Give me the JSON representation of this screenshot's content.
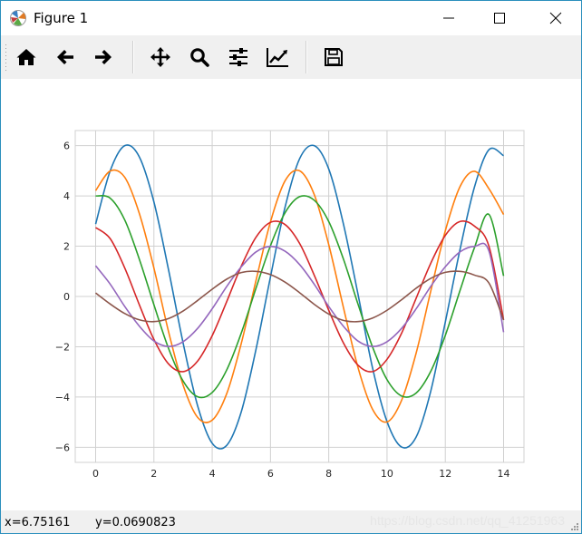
{
  "window": {
    "title": "Figure 1"
  },
  "toolbar": {
    "buttons": [
      {
        "name": "home-button",
        "icon": "home-icon"
      },
      {
        "name": "back-button",
        "icon": "arrow-left-icon"
      },
      {
        "name": "forward-button",
        "icon": "arrow-right-icon"
      },
      {
        "name": "pan-button",
        "icon": "move-arrows-icon"
      },
      {
        "name": "zoom-button",
        "icon": "magnifier-icon"
      },
      {
        "name": "subplots-button",
        "icon": "sliders-icon"
      },
      {
        "name": "edit-axes-button",
        "icon": "line-chart-icon"
      },
      {
        "name": "save-button",
        "icon": "floppy-disk-icon"
      }
    ]
  },
  "status": {
    "x_readout": "x=6.75161",
    "y_readout": "y=0.0690823",
    "watermark": "https://blog.csdn.net/qq_41251963"
  },
  "colors": {
    "window_border": "#2b8fbd",
    "toolbar_bg": "#f0f0f0",
    "grid": "#d0d0d0"
  },
  "chart_data": {
    "type": "line",
    "title": "",
    "xlabel": "",
    "ylabel": "",
    "xlim": [
      -0.7,
      14.7
    ],
    "ylim": [
      -6.6,
      6.6
    ],
    "grid": true,
    "x_ticks": [
      0,
      2,
      4,
      6,
      8,
      10,
      12,
      14
    ],
    "y_ticks": [
      -6,
      -4,
      -2,
      0,
      2,
      4,
      6
    ],
    "x_tick_labels": [
      "0",
      "2",
      "4",
      "6",
      "8",
      "10",
      "12",
      "14"
    ],
    "y_tick_labels": [
      "−6",
      "−4",
      "−2",
      "0",
      "2",
      "4",
      "6"
    ],
    "x": [
      0,
      0.5,
      1,
      1.5,
      2,
      2.5,
      3,
      3.5,
      4,
      4.5,
      5,
      5.5,
      6,
      6.5,
      7,
      7.5,
      8,
      8.5,
      9,
      9.5,
      10,
      10.5,
      11,
      11.5,
      12,
      12.5,
      13,
      13.5,
      14
    ],
    "series": [
      {
        "color": "#1f77b4",
        "values": [
          2.88,
          5.0,
          6.0,
          5.55,
          3.76,
          1.07,
          -1.84,
          -4.35,
          -5.84,
          -5.92,
          -4.58,
          -2.12,
          0.78,
          3.55,
          5.48,
          6.0,
          5.07,
          2.9,
          0.11,
          -2.83,
          -4.98,
          -5.99,
          -5.59,
          -3.77,
          -1.02,
          1.84,
          4.35,
          5.84,
          5.6
        ]
      },
      {
        "color": "#ff7f0e",
        "values": [
          4.21,
          4.99,
          4.74,
          3.3,
          1.13,
          -1.39,
          -3.52,
          -4.81,
          -4.92,
          -3.86,
          -1.86,
          0.62,
          2.97,
          4.6,
          5.0,
          4.06,
          2.06,
          -0.42,
          -2.81,
          -4.48,
          -4.99,
          -4.13,
          -2.25,
          0.21,
          2.61,
          4.36,
          4.98,
          4.28,
          3.26
        ]
      },
      {
        "color": "#2ca02c",
        "values": [
          4.0,
          3.91,
          3.04,
          1.48,
          -0.33,
          -2.06,
          -3.36,
          -3.99,
          -3.82,
          -2.92,
          -1.45,
          0.32,
          2.02,
          3.33,
          3.97,
          3.83,
          2.98,
          1.5,
          -0.29,
          -2.0,
          -3.31,
          -3.96,
          -3.84,
          -2.98,
          -1.55,
          0.22,
          1.94,
          3.26,
          0.82
        ]
      },
      {
        "color": "#d62728",
        "values": [
          2.74,
          2.3,
          1.13,
          -0.33,
          -1.71,
          -2.68,
          -2.99,
          -2.57,
          -1.56,
          -0.2,
          1.21,
          2.35,
          2.95,
          2.86,
          2.11,
          0.85,
          -0.55,
          -1.84,
          -2.73,
          -2.99,
          -2.5,
          -1.46,
          -0.07,
          1.32,
          2.43,
          2.98,
          2.8,
          1.99,
          -0.93
        ]
      },
      {
        "color": "#9467bd",
        "values": [
          1.22,
          0.49,
          -0.4,
          -1.18,
          -1.77,
          -1.99,
          -1.8,
          -1.27,
          -0.49,
          0.4,
          1.18,
          1.77,
          1.99,
          1.8,
          1.27,
          0.49,
          -0.4,
          -1.18,
          -1.77,
          -1.99,
          -1.8,
          -1.27,
          -0.49,
          0.4,
          1.18,
          1.77,
          1.99,
          1.8,
          -1.42
        ]
      },
      {
        "color": "#8c564b",
        "values": [
          0.14,
          -0.3,
          -0.68,
          -0.93,
          -1.0,
          -0.88,
          -0.58,
          -0.16,
          0.29,
          0.69,
          0.95,
          1.0,
          0.87,
          0.57,
          0.15,
          -0.31,
          -0.7,
          -0.95,
          -1.0,
          -0.86,
          -0.55,
          -0.13,
          0.33,
          0.72,
          0.96,
          1.0,
          0.85,
          0.53,
          -0.94
        ]
      }
    ]
  }
}
